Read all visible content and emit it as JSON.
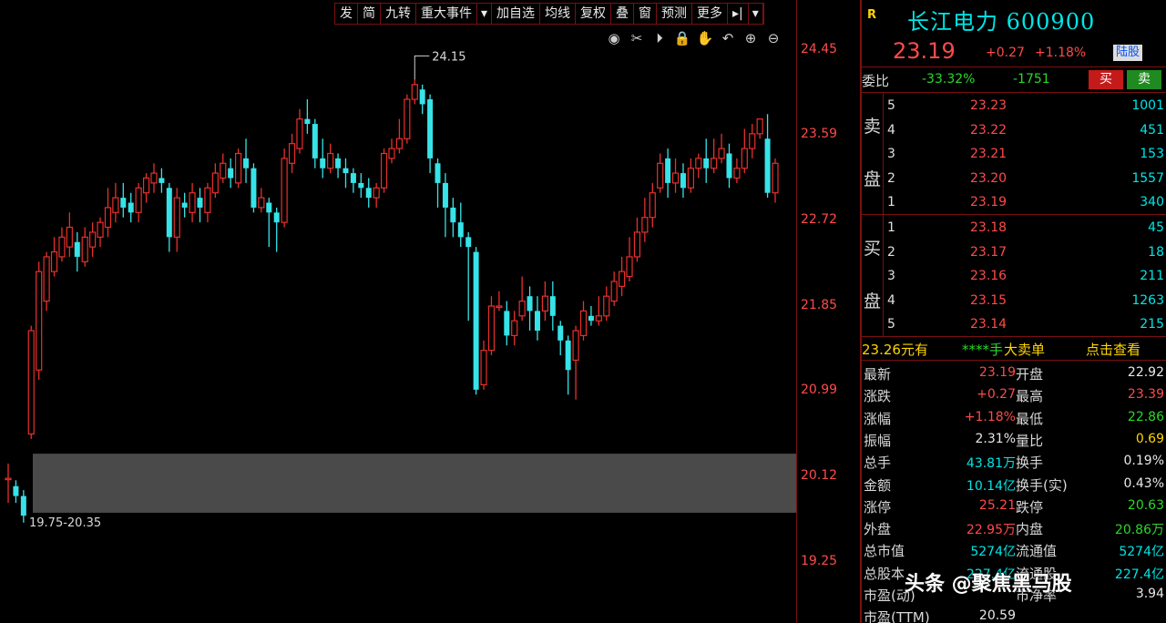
{
  "toolbar": [
    "发",
    "简",
    "九转",
    "重大事件",
    "▾",
    "加自选",
    "均线",
    "复权",
    "叠",
    "窗",
    "预测",
    "更多",
    "▸|",
    "▾"
  ],
  "chart_tools": [
    {
      "icon": "eye-icon",
      "glyph": "◉"
    },
    {
      "icon": "scissors-icon",
      "glyph": "✂"
    },
    {
      "icon": "play-icon",
      "glyph": "⏵"
    },
    {
      "icon": "lock-icon",
      "glyph": "🔒"
    },
    {
      "icon": "hand-icon",
      "glyph": "✋"
    },
    {
      "icon": "undo-icon",
      "glyph": "↶"
    },
    {
      "icon": "zoom-in-icon",
      "glyph": "⊕"
    },
    {
      "icon": "zoom-out-icon",
      "glyph": "⊖"
    }
  ],
  "chart_data": {
    "type": "candlestick",
    "y_ticks": [
      "24.45",
      "23.59",
      "22.72",
      "21.85",
      "20.99",
      "20.12",
      "19.25"
    ],
    "ylim": [
      19.25,
      24.45
    ],
    "high_label": "24.15",
    "zone_label": "19.75-20.35",
    "zone": [
      19.75,
      20.35
    ],
    "up_color": "#e8302a",
    "down_color": "#36e3e8",
    "candles": [
      [
        20.1,
        20.1,
        19.85,
        20.25
      ],
      [
        20.02,
        19.92,
        19.85,
        20.08
      ],
      [
        19.92,
        19.72,
        19.65,
        19.98
      ],
      [
        20.55,
        21.6,
        20.5,
        21.65
      ],
      [
        21.2,
        22.2,
        21.1,
        22.3
      ],
      [
        21.9,
        22.35,
        21.8,
        22.4
      ],
      [
        22.2,
        22.4,
        22.15,
        22.55
      ],
      [
        22.35,
        22.55,
        22.3,
        22.65
      ],
      [
        22.45,
        22.65,
        22.35,
        22.8
      ],
      [
        22.5,
        22.35,
        22.2,
        22.6
      ],
      [
        22.3,
        22.55,
        22.25,
        22.65
      ],
      [
        22.45,
        22.6,
        22.35,
        22.7
      ],
      [
        22.55,
        22.7,
        22.45,
        22.75
      ],
      [
        22.65,
        22.85,
        22.55,
        23.05
      ],
      [
        22.8,
        22.95,
        22.7,
        23.1
      ],
      [
        22.95,
        22.85,
        22.75,
        23.1
      ],
      [
        22.9,
        22.8,
        22.7,
        23.0
      ],
      [
        22.8,
        23.05,
        22.7,
        23.1
      ],
      [
        23.0,
        23.15,
        22.9,
        23.2
      ],
      [
        23.1,
        23.2,
        23.0,
        23.3
      ],
      [
        23.15,
        23.1,
        23.0,
        23.25
      ],
      [
        23.05,
        22.55,
        22.4,
        23.1
      ],
      [
        22.55,
        22.95,
        22.4,
        23.05
      ],
      [
        22.9,
        22.85,
        22.75,
        23.0
      ],
      [
        22.8,
        23.0,
        22.7,
        23.1
      ],
      [
        22.95,
        22.85,
        22.7,
        23.05
      ],
      [
        22.8,
        23.05,
        22.7,
        23.1
      ],
      [
        23.0,
        23.2,
        22.95,
        23.3
      ],
      [
        23.15,
        23.3,
        23.1,
        23.4
      ],
      [
        23.25,
        23.15,
        23.05,
        23.35
      ],
      [
        23.1,
        23.4,
        23.05,
        23.45
      ],
      [
        23.35,
        23.25,
        23.1,
        23.55
      ],
      [
        23.25,
        22.85,
        22.8,
        23.3
      ],
      [
        22.85,
        22.95,
        22.8,
        23.05
      ],
      [
        22.9,
        22.8,
        22.45,
        22.95
      ],
      [
        22.8,
        22.7,
        22.4,
        22.85
      ],
      [
        22.7,
        23.35,
        22.65,
        23.45
      ],
      [
        23.3,
        23.5,
        23.2,
        23.6
      ],
      [
        23.45,
        23.75,
        23.4,
        23.85
      ],
      [
        23.75,
        23.7,
        23.6,
        23.95
      ],
      [
        23.7,
        23.35,
        23.25,
        23.75
      ],
      [
        23.35,
        23.25,
        23.15,
        23.55
      ],
      [
        23.25,
        23.4,
        23.2,
        23.5
      ],
      [
        23.35,
        23.25,
        23.15,
        23.4
      ],
      [
        23.25,
        23.2,
        23.05,
        23.35
      ],
      [
        23.2,
        23.1,
        23.0,
        23.25
      ],
      [
        23.1,
        23.05,
        22.95,
        23.2
      ],
      [
        23.05,
        22.95,
        22.85,
        23.15
      ],
      [
        22.95,
        23.05,
        22.85,
        23.1
      ],
      [
        23.05,
        23.4,
        23.0,
        23.45
      ],
      [
        23.35,
        23.45,
        23.3,
        23.55
      ],
      [
        23.45,
        23.55,
        23.4,
        23.75
      ],
      [
        23.55,
        23.95,
        23.5,
        24.0
      ],
      [
        23.95,
        24.1,
        23.9,
        24.15
      ],
      [
        24.05,
        23.9,
        23.8,
        24.1
      ],
      [
        23.95,
        23.35,
        23.2,
        24.0
      ],
      [
        23.3,
        23.1,
        22.85,
        23.35
      ],
      [
        23.1,
        22.85,
        22.55,
        23.2
      ],
      [
        22.85,
        22.7,
        22.55,
        22.95
      ],
      [
        22.7,
        22.55,
        22.45,
        22.9
      ],
      [
        22.55,
        22.45,
        21.7,
        22.6
      ],
      [
        22.4,
        21.0,
        20.95,
        22.45
      ],
      [
        21.05,
        21.4,
        21.0,
        21.5
      ],
      [
        21.4,
        21.85,
        21.35,
        21.95
      ],
      [
        21.85,
        21.85,
        21.8,
        22.0
      ],
      [
        21.8,
        21.55,
        21.45,
        21.9
      ],
      [
        21.55,
        21.7,
        21.45,
        21.8
      ],
      [
        21.75,
        21.9,
        21.7,
        22.15
      ],
      [
        21.95,
        21.8,
        21.6,
        22.05
      ],
      [
        21.8,
        21.6,
        21.5,
        21.95
      ],
      [
        21.8,
        21.95,
        21.7,
        22.1
      ],
      [
        21.95,
        21.75,
        21.6,
        22.1
      ],
      [
        21.65,
        21.5,
        21.35,
        21.7
      ],
      [
        21.5,
        21.2,
        20.95,
        21.55
      ],
      [
        21.3,
        21.6,
        20.9,
        21.65
      ],
      [
        21.55,
        21.8,
        21.5,
        21.9
      ],
      [
        21.75,
        21.7,
        21.65,
        21.85
      ],
      [
        21.7,
        21.75,
        21.65,
        21.95
      ],
      [
        21.75,
        21.95,
        21.7,
        22.05
      ],
      [
        21.9,
        22.1,
        21.85,
        22.2
      ],
      [
        22.05,
        22.2,
        21.95,
        22.35
      ],
      [
        22.15,
        22.35,
        22.1,
        22.55
      ],
      [
        22.35,
        22.6,
        22.3,
        22.75
      ],
      [
        22.6,
        22.75,
        22.5,
        22.95
      ],
      [
        22.75,
        23.0,
        22.65,
        23.1
      ],
      [
        23.05,
        23.3,
        23.0,
        23.4
      ],
      [
        23.35,
        23.1,
        22.95,
        23.45
      ],
      [
        23.1,
        23.2,
        23.0,
        23.35
      ],
      [
        23.2,
        23.05,
        22.95,
        23.3
      ],
      [
        23.05,
        23.25,
        23.0,
        23.35
      ],
      [
        23.25,
        23.35,
        23.15,
        23.4
      ],
      [
        23.35,
        23.25,
        23.1,
        23.55
      ],
      [
        23.25,
        23.35,
        23.2,
        23.55
      ],
      [
        23.35,
        23.45,
        23.3,
        23.6
      ],
      [
        23.4,
        23.15,
        23.05,
        23.5
      ],
      [
        23.15,
        23.25,
        23.1,
        23.35
      ],
      [
        23.25,
        23.45,
        23.2,
        23.65
      ],
      [
        23.45,
        23.6,
        23.35,
        23.7
      ],
      [
        23.6,
        23.75,
        23.55,
        23.75
      ],
      [
        23.55,
        23.0,
        22.95,
        23.8
      ],
      [
        23.0,
        23.3,
        22.9,
        23.35
      ]
    ]
  },
  "header": {
    "badge": "R",
    "name": "长江电力 600900",
    "price": "23.19",
    "change": "+0.27",
    "pct": "+1.18%",
    "tag": "陆股"
  },
  "weibi": {
    "label": "委比",
    "ratio": "-33.32%",
    "diff": "-1751",
    "buy_btn": "买",
    "sell_btn": "卖"
  },
  "sell_side_label": [
    "卖",
    "盘"
  ],
  "buy_side_label": [
    "买",
    "盘"
  ],
  "asks": [
    {
      "level": "5",
      "price": "23.23",
      "vol": "1001"
    },
    {
      "level": "4",
      "price": "23.22",
      "vol": "451"
    },
    {
      "level": "3",
      "price": "23.21",
      "vol": "153"
    },
    {
      "level": "2",
      "price": "23.20",
      "vol": "1557"
    },
    {
      "level": "1",
      "price": "23.19",
      "vol": "340"
    }
  ],
  "bids": [
    {
      "level": "1",
      "price": "23.18",
      "vol": "45"
    },
    {
      "level": "2",
      "price": "23.17",
      "vol": "18"
    },
    {
      "level": "3",
      "price": "23.16",
      "vol": "211"
    },
    {
      "level": "4",
      "price": "23.15",
      "vol": "1263"
    },
    {
      "level": "5",
      "price": "23.14",
      "vol": "215"
    }
  ],
  "big_order": {
    "price": "23.26元有",
    "stars": "****手",
    "type": "大卖单",
    "link": "点击查看"
  },
  "stats": [
    {
      "k1": "最新",
      "v1": "23.19",
      "c1": "#ff4a4a",
      "k2": "开盘",
      "v2": "22.92",
      "c2": "#e8e8e8"
    },
    {
      "k1": "涨跌",
      "v1": "+0.27",
      "c1": "#ff4a4a",
      "k2": "最高",
      "v2": "23.39",
      "c2": "#ff4a4a"
    },
    {
      "k1": "涨幅",
      "v1": "+1.18%",
      "c1": "#ff4a4a",
      "k2": "最低",
      "v2": "22.86",
      "c2": "#2bd72b"
    },
    {
      "k1": "振幅",
      "v1": "2.31%",
      "c1": "#e8e8e8",
      "k2": "量比",
      "v2": "0.69",
      "c2": "#ffd500"
    },
    {
      "k1": "总手",
      "v1": "43.81万",
      "c1": "#00e6e6",
      "k2": "换手",
      "v2": "0.19%",
      "c2": "#e8e8e8"
    },
    {
      "k1": "金额",
      "v1": "10.14亿",
      "c1": "#00e6e6",
      "k2": "换手(实)",
      "v2": "0.43%",
      "c2": "#e8e8e8"
    },
    {
      "k1": "涨停",
      "v1": "25.21",
      "c1": "#ff4a4a",
      "k2": "跌停",
      "v2": "20.63",
      "c2": "#2bd72b"
    },
    {
      "k1": "外盘",
      "v1": "22.95万",
      "c1": "#ff4a4a",
      "k2": "内盘",
      "v2": "20.86万",
      "c2": "#2bd72b"
    },
    {
      "k1": "总市值",
      "v1": "5274亿",
      "c1": "#00e6e6",
      "k2": "流通值",
      "v2": "5274亿",
      "c2": "#00e6e6"
    },
    {
      "k1": "总股本",
      "v1": "227.4亿",
      "c1": "#00e6e6",
      "k2": "流通股",
      "v2": "227.4亿",
      "c2": "#00e6e6"
    },
    {
      "k1": "市盈(动)",
      "v1": "",
      "c1": "#e8e8e8",
      "k2": "市净率",
      "v2": "3.94",
      "c2": "#e8e8e8"
    },
    {
      "k1": "市盈(TTM)",
      "v1": "20.59",
      "c1": "#e8e8e8",
      "k2": "",
      "v2": "",
      "c2": "#e8e8e8"
    }
  ],
  "watermark": "头条 @聚焦黑马股"
}
